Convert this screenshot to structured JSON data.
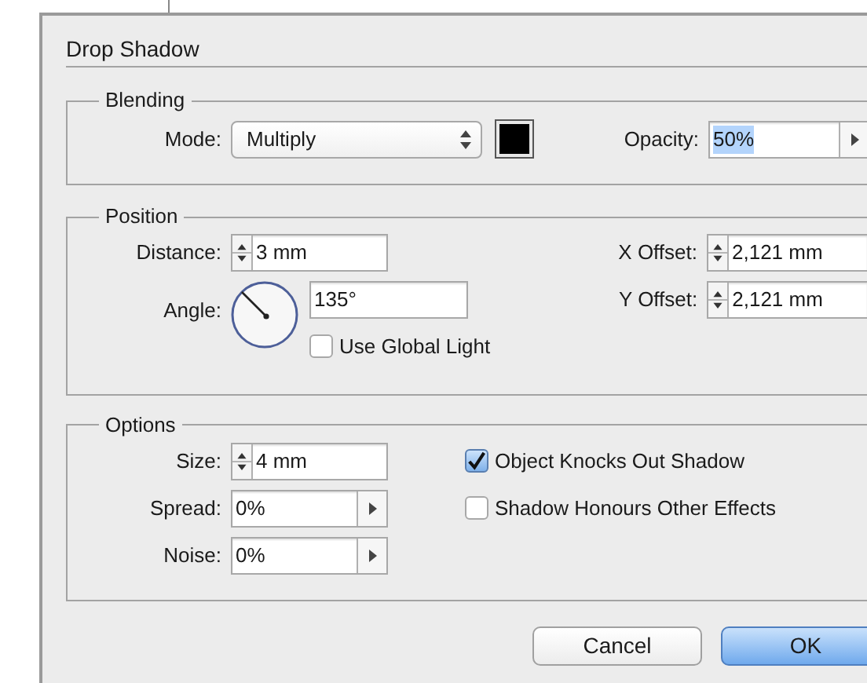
{
  "window": {
    "title": "Drop Shadow"
  },
  "blending": {
    "title": "Blending",
    "mode": {
      "label": "Mode:",
      "value": "Multiply"
    },
    "opacity": {
      "label": "Opacity:",
      "value": "50%",
      "kind": "menu",
      "selected": true
    }
  },
  "position": {
    "title": "Position",
    "distance": {
      "label": "Distance:",
      "value": "3 mm",
      "kind": "stepper"
    },
    "angle": {
      "label": "Angle:",
      "value": "135°"
    },
    "use_global_light": {
      "label": "Use Global Light",
      "checked": false
    },
    "x_offset": {
      "label": "X Offset:",
      "value": "2,121 mm",
      "kind": "stepper"
    },
    "y_offset": {
      "label": "Y Offset:",
      "value": "2,121 mm",
      "kind": "stepper"
    }
  },
  "options": {
    "title": "Options",
    "fields": [
      {
        "label": "Size:",
        "value": "4 mm",
        "kind": "stepper"
      },
      {
        "label": "Spread:",
        "value": "0%",
        "kind": "menu"
      },
      {
        "label": "Noise:",
        "value": "0%",
        "kind": "menu"
      }
    ],
    "checkboxes": [
      {
        "label": "Object Knocks Out Shadow",
        "checked": true
      },
      {
        "label": "Shadow Honours Other Effects",
        "checked": false
      }
    ]
  },
  "buttons": [
    {
      "label": "Cancel",
      "default": false
    },
    {
      "label": "OK",
      "default": true
    }
  ]
}
